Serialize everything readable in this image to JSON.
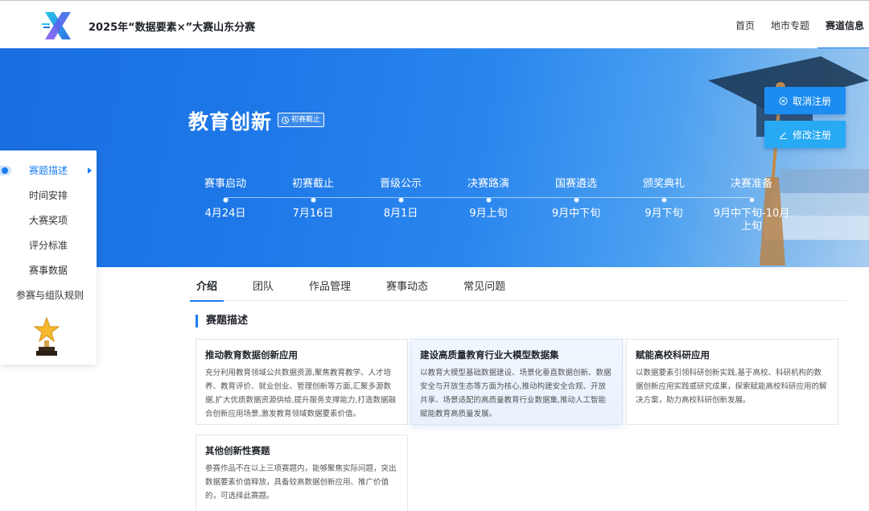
{
  "header": {
    "title": "2025年“数据要素×”大赛山东分赛",
    "nav": [
      "首页",
      "地市专题",
      "赛道信息"
    ],
    "colors": {
      "accent": "#1c7df0",
      "logo_blue": "#2f6fe4",
      "logo_cyan": "#27c7e8",
      "logo_purple": "#8b5cf6"
    }
  },
  "banner": {
    "title": "教育创新",
    "badge": "初赛截止",
    "buttons": {
      "cancel": "取消注册",
      "edit": "修改注册"
    },
    "timeline": [
      {
        "label": "赛事启动",
        "date": "4月24日"
      },
      {
        "label": "初赛截止",
        "date": "7月16日"
      },
      {
        "label": "晋级公示",
        "date": "8月1日"
      },
      {
        "label": "决赛路演",
        "date": "9月上旬"
      },
      {
        "label": "国赛遴选",
        "date": "9月中下旬"
      },
      {
        "label": "颁奖典礼",
        "date": "9月下旬"
      },
      {
        "label": "决赛准备",
        "date": "9月中下旬-10月上旬"
      }
    ]
  },
  "sidebar": {
    "items": [
      "赛题描述",
      "时间安排",
      "大赛奖项",
      "评分标准",
      "赛事数据",
      "参赛与组队规则"
    ],
    "active_index": 0
  },
  "tabs": [
    "介绍",
    "团队",
    "作品管理",
    "赛事动态",
    "常见问题"
  ],
  "section": {
    "title": "赛题描述",
    "cards": [
      {
        "title": "推动教育数据创新应用",
        "text": "充分利用教育领域公共数据资源,聚焦教育教学、人才培养、教育评价、就业创业、管理创新等方面,汇聚多源数据,扩大优质数据资源供给,提升服务支撑能力,打造数据融合创新应用场景,激发教育领域数据要素价值。"
      },
      {
        "title": "建设高质量教育行业大模型数据集",
        "text": "以教育大模型基础数据建设、场景化垂直数据创新、数据安全与开放生态等方面为核心,推动构建安全合规、开放共享、场景适配的高质量教育行业数据集,推动人工智能赋能教育高质量发展。"
      },
      {
        "title": "赋能高校科研应用",
        "text": "以数据要素引领科研创新实践,基于高校、科研机构的数据创新应用实践或研究成果，探索赋能高校科研应用的解决方案，助力高校科研创新发展。"
      },
      {
        "title": "其他创新性赛题",
        "text": "参赛作品不在以上三项赛题内，能够聚焦实际问题，突出数据要素价值释放，具备较高数据创新应用、推广价值的，可选择此赛题。"
      }
    ]
  }
}
